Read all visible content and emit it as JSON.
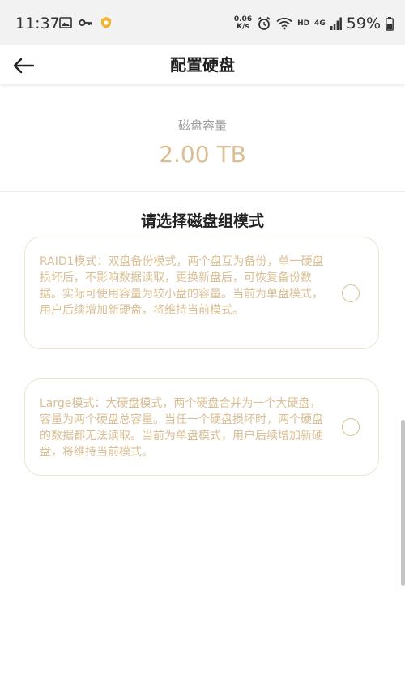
{
  "status_bar": {
    "time": "11:37",
    "left_icons": [
      "image-icon",
      "key-icon",
      "shield-badge-icon"
    ],
    "net_speed_value": "0.06",
    "net_speed_unit": "K/s",
    "network_label": "HD",
    "network_type": "4G",
    "battery": "59%",
    "right_icons": [
      "alarm-icon",
      "wifi-icon",
      "signal-icon",
      "battery-icon"
    ]
  },
  "header": {
    "title": "配置硬盘",
    "back_icon": "arrow-left-icon"
  },
  "capacity": {
    "label": "磁盘容量",
    "value": "2.00 TB"
  },
  "section_title": "请选择磁盘组模式",
  "options": [
    {
      "name": "RAID1",
      "description": "RAID1模式：双盘备份模式，两个盘互为备份，单一硬盘损坏后，不影响数据读取，更换新盘后，可恢复备份数据。实际可使用容量为较小盘的容量。当前为单盘模式，用户后续增加新硬盘，将维持当前模式。",
      "selected": false
    },
    {
      "name": "Large",
      "description": "Large模式：大硬盘模式，两个硬盘合并为一个大硬盘，容量为两个硬盘总容量。当任一个硬盘损坏时，两个硬盘的数据都无法读取。当前为单盘模式，用户后续增加新硬盘，将维持当前模式。",
      "selected": false
    }
  ],
  "colors": {
    "accent": "#d9bf93",
    "card_border": "#ede4d2",
    "status_bar_bg": "#f2f2f2"
  }
}
